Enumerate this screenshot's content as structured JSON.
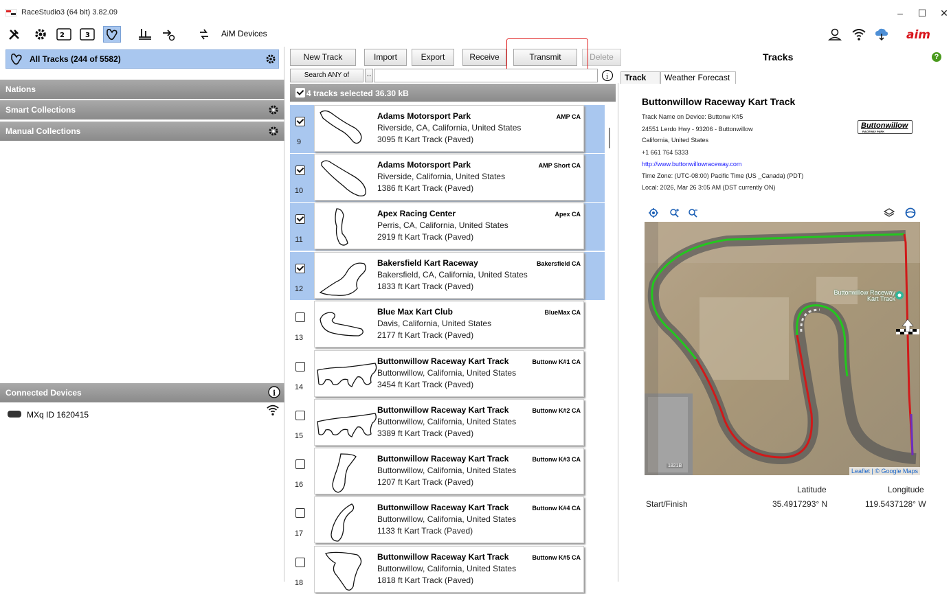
{
  "window": {
    "title": "RaceStudio3 (64 bit) 3.82.09",
    "minimize": "–",
    "maximize": "☐",
    "close": "✕"
  },
  "toolbar": {
    "aim_devices_label": "AiM Devices"
  },
  "left": {
    "all_tracks_label": "All Tracks  (244 of 5582)",
    "nations_label": "Nations",
    "smart_collections_label": "Smart Collections",
    "manual_collections_label": "Manual Collections",
    "connected_devices_label": "Connected Devices",
    "device_name": "MXq ID 1620415"
  },
  "actions": {
    "new_track": "New Track",
    "import": "Import",
    "export": "Export",
    "receive": "Receive",
    "transmit": "Transmit",
    "delete": "Delete",
    "search_any": "Search ANY of",
    "search_dots": "...",
    "search_value": ""
  },
  "selection": {
    "summary": "4 tracks selected 36.30 kB"
  },
  "tracks": [
    {
      "num": "9",
      "name": "Adams Motorsport Park",
      "short": "AMP CA",
      "location": "Riverside, CA, California, United States",
      "length": "3095 ft Kart Track (Paved)",
      "checked": true
    },
    {
      "num": "10",
      "name": "Adams Motorsport Park",
      "short": "AMP Short CA",
      "location": "Riverside, California, United States",
      "length": "1386 ft Kart Track (Paved)",
      "checked": true
    },
    {
      "num": "11",
      "name": "Apex Racing Center",
      "short": "Apex CA",
      "location": "Perris, CA, California, United States",
      "length": "2919 ft Kart Track (Paved)",
      "checked": true
    },
    {
      "num": "12",
      "name": "Bakersfield Kart Raceway",
      "short": "Bakersfield CA",
      "location": "Bakersfield, CA, California, United States",
      "length": "1833 ft Kart Track (Paved)",
      "checked": true
    },
    {
      "num": "13",
      "name": "Blue Max Kart Club",
      "short": "BlueMax CA",
      "location": "Davis, California, United States",
      "length": "2177 ft Kart Track (Paved)",
      "checked": false
    },
    {
      "num": "14",
      "name": "Buttonwillow Raceway Kart Track",
      "short": "Buttonw K#1 CA",
      "location": "Buttonwillow, California, United States",
      "length": "3454 ft Kart Track (Paved)",
      "checked": false
    },
    {
      "num": "15",
      "name": "Buttonwillow Raceway Kart Track",
      "short": "Buttonw K#2 CA",
      "location": "Buttonwillow, California, United States",
      "length": "3389 ft Kart Track (Paved)",
      "checked": false
    },
    {
      "num": "16",
      "name": "Buttonwillow Raceway Kart Track",
      "short": "Buttonw K#3 CA",
      "location": "Buttonwillow, California, United States",
      "length": "1207 ft Kart Track (Paved)",
      "checked": false
    },
    {
      "num": "17",
      "name": "Buttonwillow Raceway Kart Track",
      "short": "Buttonw K#4 CA",
      "location": "Buttonwillow, California, United States",
      "length": "1133 ft Kart Track (Paved)",
      "checked": false
    },
    {
      "num": "18",
      "name": "Buttonwillow Raceway Kart Track",
      "short": "Buttonw K#5 CA",
      "location": "Buttonwillow, California, United States",
      "length": "1818 ft Kart Track (Paved)",
      "checked": false
    }
  ],
  "right": {
    "panel_title": "Tracks",
    "help": "?",
    "tab_track": "Track",
    "tab_weather": "Weather Forecast",
    "track_title": "Buttonwillow Raceway Kart Track",
    "name_on_device": "Track Name on Device: Buttonw K#5",
    "address": "24551 Lerdo Hwy - 93206 - Buttonwillow",
    "region": "California, United States",
    "phone": "+1 661 764 5333",
    "website": "http://www.buttonwillowraceway.com",
    "timezone": "Time Zone: (UTC-08:00) Pacific Time (US _Canada) (PDT)",
    "local_time": "Local: 2026, Mar 26 3:05 AM (DST currently ON)",
    "logo_text": "Buttonwillow",
    "logo_sub": "RACEWAY PARK",
    "map_label": "Buttonwillow Raceway Kart Track",
    "map_attribution": "Leaflet | © Google Maps",
    "map_road_label": "1821B",
    "lat_header": "Latitude",
    "lon_header": "Longitude",
    "start_finish": "Start/Finish",
    "lat_value": "35.4917293° N",
    "lon_value": "119.5437128° W"
  },
  "colors": {
    "selection_blue": "#a9c7ef",
    "header_gray": "#8f8f8f",
    "highlight_red": "#e02020",
    "track_green": "#22c81e",
    "track_red": "#d01a1a"
  }
}
